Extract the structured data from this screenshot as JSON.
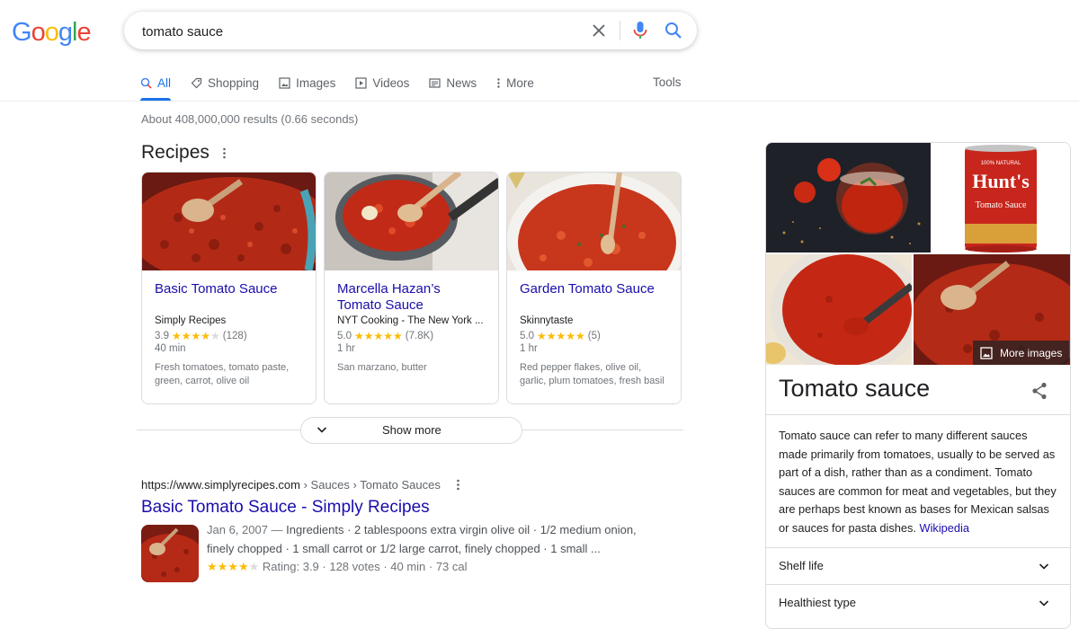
{
  "logo": {
    "letters": [
      "G",
      "o",
      "o",
      "g",
      "l",
      "e"
    ],
    "colors": [
      "#4285f4",
      "#ea4335",
      "#fbbc05",
      "#4285f4",
      "#34a853",
      "#ea4335"
    ]
  },
  "search": {
    "query": "tomato sauce"
  },
  "tabs": [
    {
      "label": "All",
      "icon": "search-icon",
      "active": true
    },
    {
      "label": "Shopping",
      "icon": "tag-icon"
    },
    {
      "label": "Images",
      "icon": "image-icon"
    },
    {
      "label": "Videos",
      "icon": "play-icon"
    },
    {
      "label": "News",
      "icon": "news-icon"
    },
    {
      "label": "More",
      "icon": "more-vert-icon"
    }
  ],
  "tools_label": "Tools",
  "results_stats": "About 408,000,000 results (0.66 seconds)",
  "recipes": {
    "title": "Recipes",
    "cards": [
      {
        "title": "Basic Tomato Sauce",
        "source": "Simply Recipes",
        "rating": "3.9",
        "stars": 4,
        "votes": "(128)",
        "time": "40 min",
        "ingredients": "Fresh tomatoes, tomato paste, green, carrot, olive oil"
      },
      {
        "title": "Marcella Hazan’s Tomato Sauce",
        "source": "NYT Cooking - The New York ...",
        "rating": "5.0",
        "stars": 5,
        "votes": "(7.8K)",
        "time": "1 hr",
        "ingredients": "San marzano, butter"
      },
      {
        "title": "Garden Tomato Sauce",
        "source": "Skinnytaste",
        "rating": "5.0",
        "stars": 5,
        "votes": "(5)",
        "time": "1 hr",
        "ingredients": "Red pepper flakes, olive oil, garlic, plum tomatoes, fresh basil"
      }
    ],
    "show_more": "Show more"
  },
  "result": {
    "url": "https://www.simplyrecipes.com",
    "breadcrumb": " › Sauces › Tomato Sauces",
    "title": "Basic Tomato Sauce - Simply Recipes",
    "date": "Jan 6, 2007 — ",
    "snippet": "Ingredients · 2 tablespoons extra virgin olive oil · 1/2 medium onion, finely chopped · 1 small carrot or 1/2 large carrot, finely chopped · 1 small ...",
    "rating_text": "Rating: 3.9 · 128 votes · 40 min · 73 cal",
    "stars": 4
  },
  "knowledge_panel": {
    "more_images": "More images",
    "title": "Tomato sauce",
    "description": "Tomato sauce can refer to many different sauces made primarily from tomatoes, usually to be served as part of a dish, rather than as a condiment. Tomato sauces are common for meat and vegetables, but they are perhaps best known as bases for Mexican salsas or sauces for pasta dishes. ",
    "wiki_link": "Wikipedia",
    "can_brand": "Hunt's",
    "can_top": "100% NATURAL",
    "can_product": "Tomato Sauce",
    "rows": [
      "Shelf life",
      "Healthiest type"
    ]
  },
  "colors": {
    "link": "#1a0dab",
    "accent": "#1a73e8",
    "star": "#fbbc04"
  }
}
